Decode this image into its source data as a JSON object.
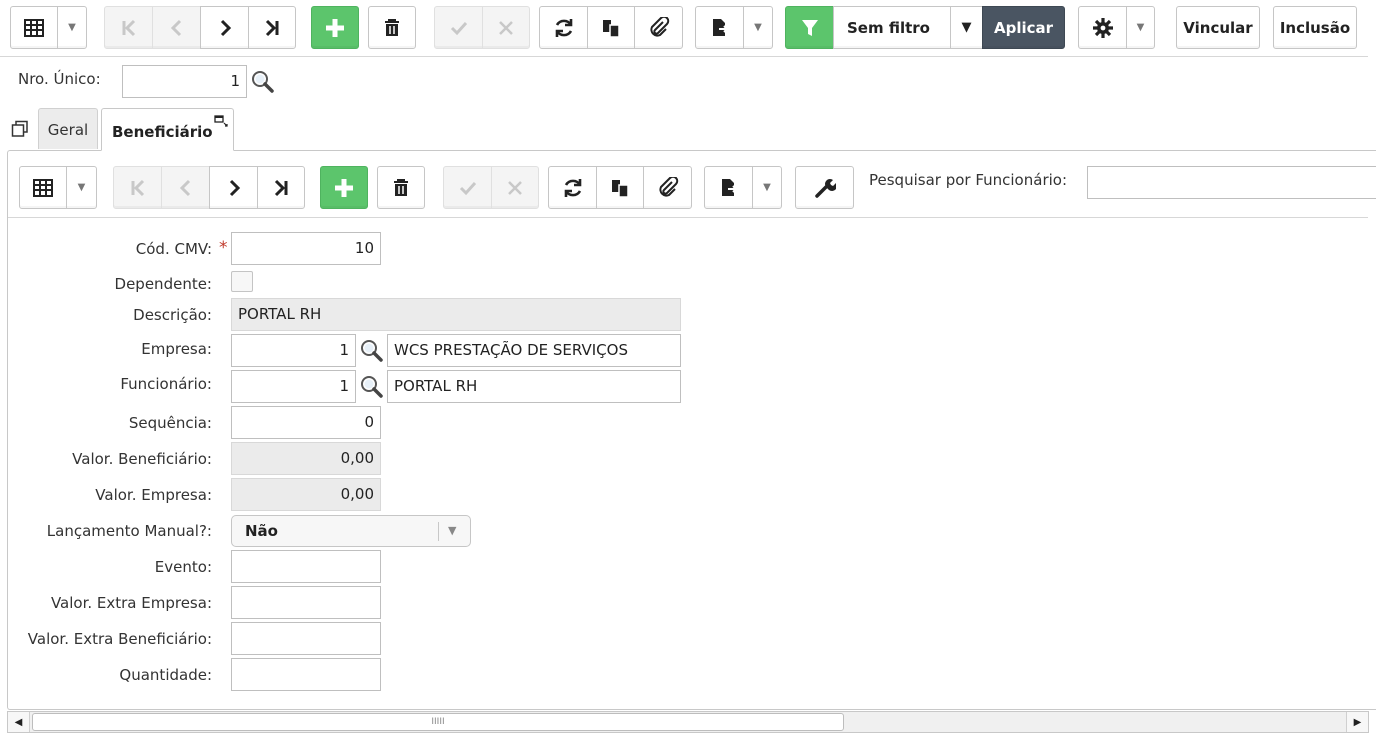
{
  "main_toolbar": {
    "filter_label": "Sem filtro",
    "apply_label": "Aplicar",
    "link_label": "Vincular",
    "include_label": "Inclusão"
  },
  "header_form": {
    "nro_unico_label": "Nro. Único:",
    "nro_unico_value": "1"
  },
  "tabs": [
    {
      "label": "Geral",
      "active": false
    },
    {
      "label": "Beneficiário",
      "active": true
    }
  ],
  "detail_toolbar": {
    "search_label": "Pesquisar por Funcionário:",
    "search_value": ""
  },
  "form": {
    "cod_cmv_label": "Cód. CMV:",
    "cod_cmv_value": "10",
    "required_mark": "*",
    "dependente_label": "Dependente:",
    "dependente_checked": false,
    "descricao_label": "Descrição:",
    "descricao_value": "PORTAL RH",
    "empresa_label": "Empresa:",
    "empresa_code": "1",
    "empresa_name": "WCS PRESTAÇÃO DE SERVIÇOS",
    "funcionario_label": "Funcionário:",
    "funcionario_code": "1",
    "funcionario_name": "PORTAL RH",
    "sequencia_label": "Sequência:",
    "sequencia_value": "0",
    "valor_beneficiario_label": "Valor. Beneficiário:",
    "valor_beneficiario_value": "0,00",
    "valor_empresa_label": "Valor. Empresa:",
    "valor_empresa_value": "0,00",
    "lancamento_label": "Lançamento Manual?:",
    "lancamento_value": "Não",
    "evento_label": "Evento:",
    "evento_value": "",
    "valor_extra_empresa_label": "Valor. Extra Empresa:",
    "valor_extra_empresa_value": "",
    "valor_extra_beneficiario_label": "Valor. Extra Beneficiário:",
    "valor_extra_beneficiario_value": "",
    "quantidade_label": "Quantidade:",
    "quantidade_value": ""
  },
  "scrollbar": {
    "grip": "IIIII"
  },
  "colors": {
    "accent_green": "#5cc56c",
    "apply_dark": "#4a5562",
    "required_red": "#c0392b"
  },
  "icons": [
    "grid-icon",
    "first-icon",
    "prev-icon",
    "next-icon",
    "last-icon",
    "add-icon",
    "trash-icon",
    "confirm-icon",
    "cancel-icon",
    "refresh-icon",
    "copy-icon",
    "attach-icon",
    "export-icon",
    "filter-icon",
    "gear-icon",
    "wrench-icon",
    "search-icon"
  ]
}
